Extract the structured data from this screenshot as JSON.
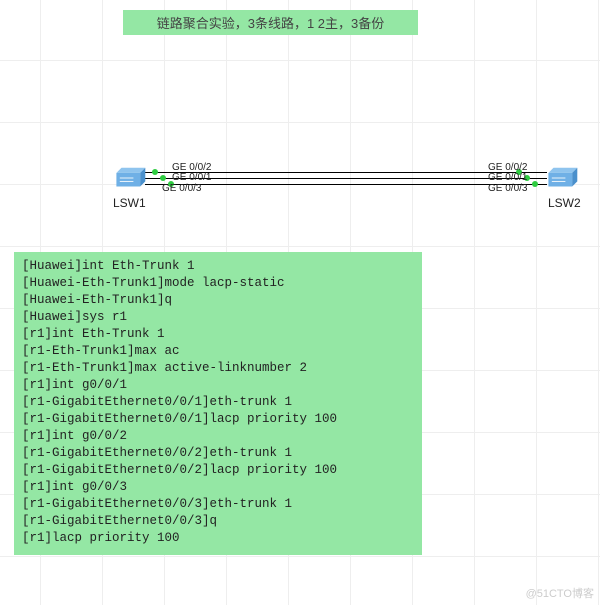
{
  "title": "链路聚合实验，3条线路，1 2主，3备份",
  "devices": {
    "left": {
      "name": "LSW1"
    },
    "right": {
      "name": "LSW2"
    }
  },
  "ports": {
    "left": {
      "top": "GE 0/0/2",
      "mid": "GE 0/0/1",
      "bot": "GE 0/0/3"
    },
    "right": {
      "top": "GE 0/0/2",
      "mid": "GE 0/0/1",
      "bot": "GE 0/0/3"
    }
  },
  "cli_lines": [
    "[Huawei]int Eth-Trunk 1",
    "[Huawei-Eth-Trunk1]mode lacp-static",
    "[Huawei-Eth-Trunk1]q",
    "[Huawei]sys r1",
    "[r1]int Eth-Trunk 1",
    "[r1-Eth-Trunk1]max ac",
    "[r1-Eth-Trunk1]max active-linknumber 2",
    "[r1]int g0/0/1",
    "[r1-GigabitEthernet0/0/1]eth-trunk 1",
    "[r1-GigabitEthernet0/0/1]lacp priority 100",
    "[r1]int g0/0/2",
    "[r1-GigabitEthernet0/0/2]eth-trunk 1",
    "[r1-GigabitEthernet0/0/2]lacp priority 100",
    "[r1]int g0/0/3",
    "[r1-GigabitEthernet0/0/3]eth-trunk 1",
    "[r1-GigabitEthernet0/0/3]q",
    "[r1]lacp priority 100"
  ],
  "watermark": "@51CTO博客"
}
